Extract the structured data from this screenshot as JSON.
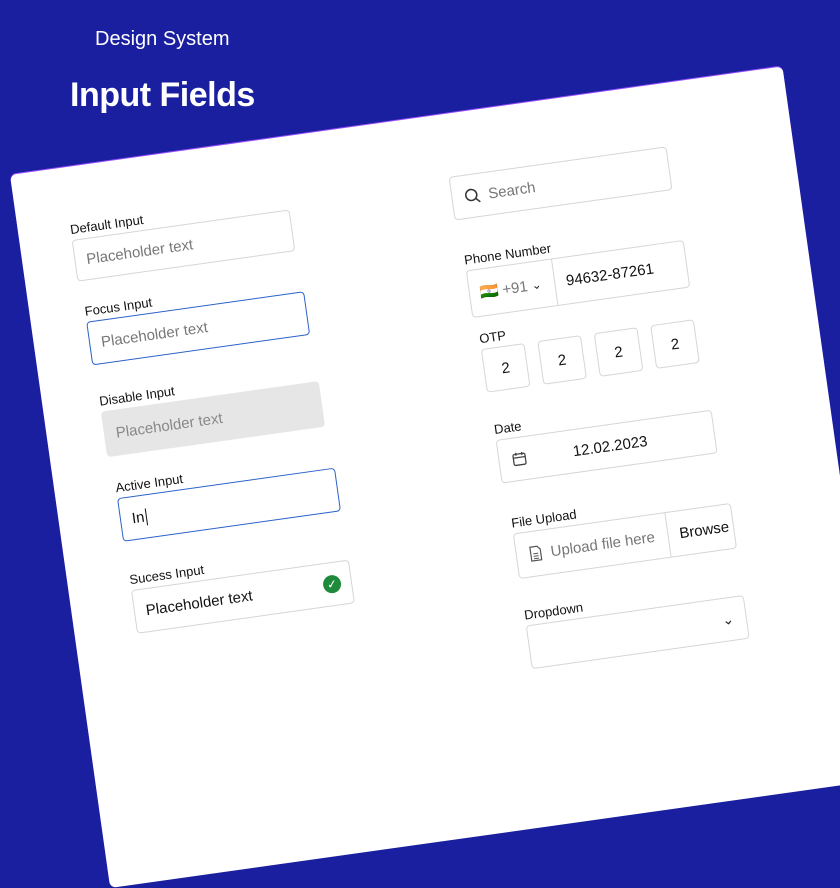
{
  "header": {
    "subtitle": "Design System",
    "title": "Input Fields"
  },
  "left": {
    "default": {
      "label": "Default Input",
      "placeholder": "Placeholder text"
    },
    "focus": {
      "label": "Focus Input",
      "placeholder": "Placeholder text"
    },
    "disabled": {
      "label": "Disable Input",
      "placeholder": "Placeholder text"
    },
    "active": {
      "label": "Active Input",
      "value": "In"
    },
    "success": {
      "label": "Sucess Input",
      "value": "Placeholder text"
    }
  },
  "right": {
    "search": {
      "placeholder": "Search"
    },
    "phone": {
      "label": "Phone Number",
      "flag": "🇮🇳",
      "code": "+91",
      "value": "94632-87261"
    },
    "otp": {
      "label": "OTP",
      "digits": [
        "2",
        "2",
        "2",
        "2"
      ]
    },
    "date": {
      "label": "Date",
      "value": "12.02.2023"
    },
    "file": {
      "label": "File Upload",
      "placeholder": "Upload file here",
      "button": "Browse"
    },
    "dropdown": {
      "label": "Dropdown"
    }
  },
  "colors": {
    "background": "#1a1fa0",
    "focus": "#2a62c9",
    "success": "#1f8a3b"
  }
}
